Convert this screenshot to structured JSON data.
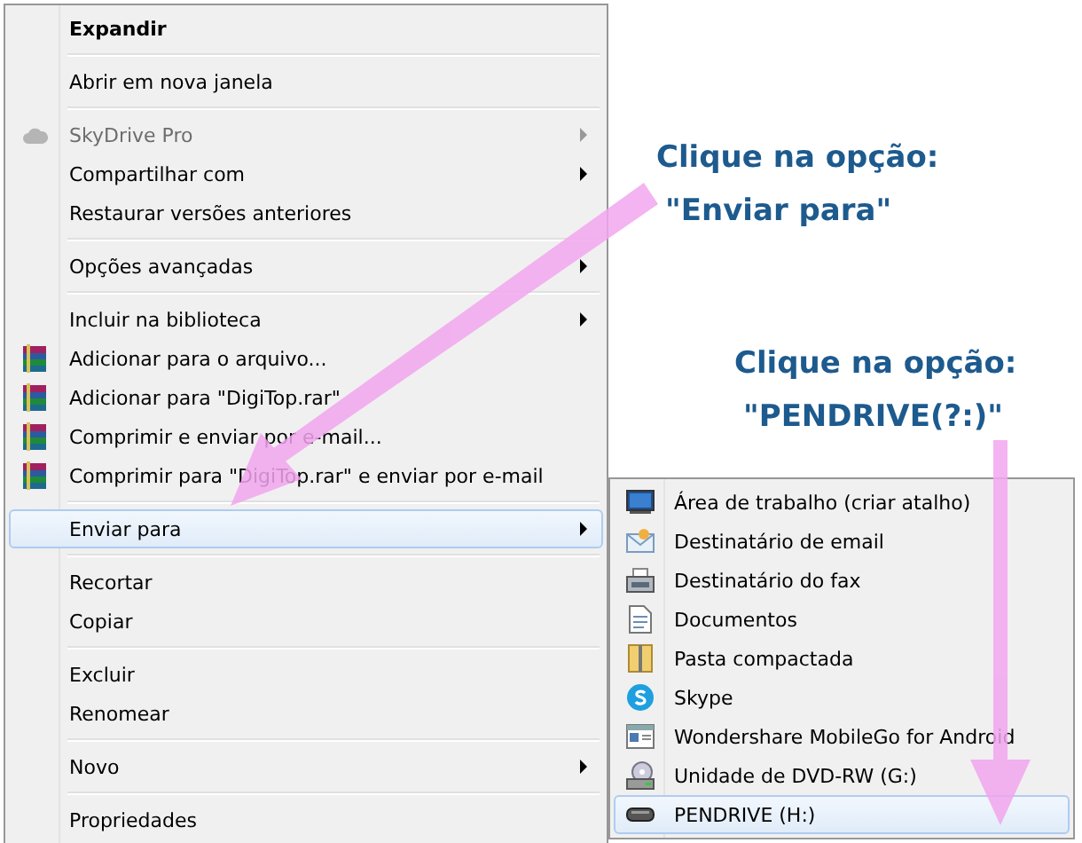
{
  "context_menu": {
    "items": [
      {
        "kind": "plain",
        "label": "Expandir",
        "bold": true,
        "disabled": false,
        "selected": false,
        "submenu": false
      },
      {
        "kind": "separator"
      },
      {
        "kind": "plain",
        "label": "Abrir em nova janela",
        "bold": false,
        "disabled": false,
        "selected": false,
        "submenu": false
      },
      {
        "kind": "separator"
      },
      {
        "kind": "cloud",
        "label": "SkyDrive Pro",
        "bold": false,
        "disabled": true,
        "selected": false,
        "submenu": true
      },
      {
        "kind": "plain",
        "label": "Compartilhar com",
        "bold": false,
        "disabled": false,
        "selected": false,
        "submenu": true
      },
      {
        "kind": "plain",
        "label": "Restaurar versões anteriores",
        "bold": false,
        "disabled": false,
        "selected": false,
        "submenu": false
      },
      {
        "kind": "separator"
      },
      {
        "kind": "plain",
        "label": "Opções avançadas",
        "bold": false,
        "disabled": false,
        "selected": false,
        "submenu": true
      },
      {
        "kind": "separator"
      },
      {
        "kind": "plain",
        "label": "Incluir na biblioteca",
        "bold": false,
        "disabled": false,
        "selected": false,
        "submenu": true
      },
      {
        "kind": "archive",
        "label": "Adicionar para o arquivo...",
        "bold": false,
        "disabled": false,
        "selected": false,
        "submenu": false
      },
      {
        "kind": "archive",
        "label": "Adicionar para \"DigiTop.rar\"",
        "bold": false,
        "disabled": false,
        "selected": false,
        "submenu": false
      },
      {
        "kind": "archive",
        "label": "Comprimir e enviar por e-mail...",
        "bold": false,
        "disabled": false,
        "selected": false,
        "submenu": false
      },
      {
        "kind": "archive",
        "label": "Comprimir para \"DigiTop.rar\" e enviar por e-mail",
        "bold": false,
        "disabled": false,
        "selected": false,
        "submenu": false
      },
      {
        "kind": "separator"
      },
      {
        "kind": "plain",
        "label": "Enviar para",
        "bold": false,
        "disabled": false,
        "selected": true,
        "submenu": true
      },
      {
        "kind": "separator"
      },
      {
        "kind": "plain",
        "label": "Recortar",
        "bold": false,
        "disabled": false,
        "selected": false,
        "submenu": false
      },
      {
        "kind": "plain",
        "label": "Copiar",
        "bold": false,
        "disabled": false,
        "selected": false,
        "submenu": false
      },
      {
        "kind": "separator"
      },
      {
        "kind": "plain",
        "label": "Excluir",
        "bold": false,
        "disabled": false,
        "selected": false,
        "submenu": false
      },
      {
        "kind": "plain",
        "label": "Renomear",
        "bold": false,
        "disabled": false,
        "selected": false,
        "submenu": false
      },
      {
        "kind": "separator"
      },
      {
        "kind": "plain",
        "label": "Novo",
        "bold": false,
        "disabled": false,
        "selected": false,
        "submenu": true
      },
      {
        "kind": "separator"
      },
      {
        "kind": "plain",
        "label": "Propriedades",
        "bold": false,
        "disabled": false,
        "selected": false,
        "submenu": false
      }
    ]
  },
  "send_to_menu": {
    "items": [
      {
        "kind": "desktop",
        "label": "Área de trabalho (criar atalho)",
        "selected": false
      },
      {
        "kind": "mail",
        "label": "Destinatário de email",
        "selected": false
      },
      {
        "kind": "fax",
        "label": "Destinatário do fax",
        "selected": false
      },
      {
        "kind": "document",
        "label": "Documentos",
        "selected": false
      },
      {
        "kind": "zip",
        "label": "Pasta compactada",
        "selected": false
      },
      {
        "kind": "skype",
        "label": "Skype",
        "selected": false
      },
      {
        "kind": "app",
        "label": "Wondershare MobileGo for Android",
        "selected": false
      },
      {
        "kind": "dvd",
        "label": "Unidade de DVD-RW (G:)",
        "selected": false
      },
      {
        "kind": "drive",
        "label": "PENDRIVE (H:)",
        "selected": true
      }
    ]
  },
  "callouts": [
    {
      "lines": [
        "Clique na opção:",
        "\"Enviar para\""
      ]
    },
    {
      "lines": [
        "Clique na opção:",
        "\"PENDRIVE(?:)\""
      ]
    }
  ]
}
